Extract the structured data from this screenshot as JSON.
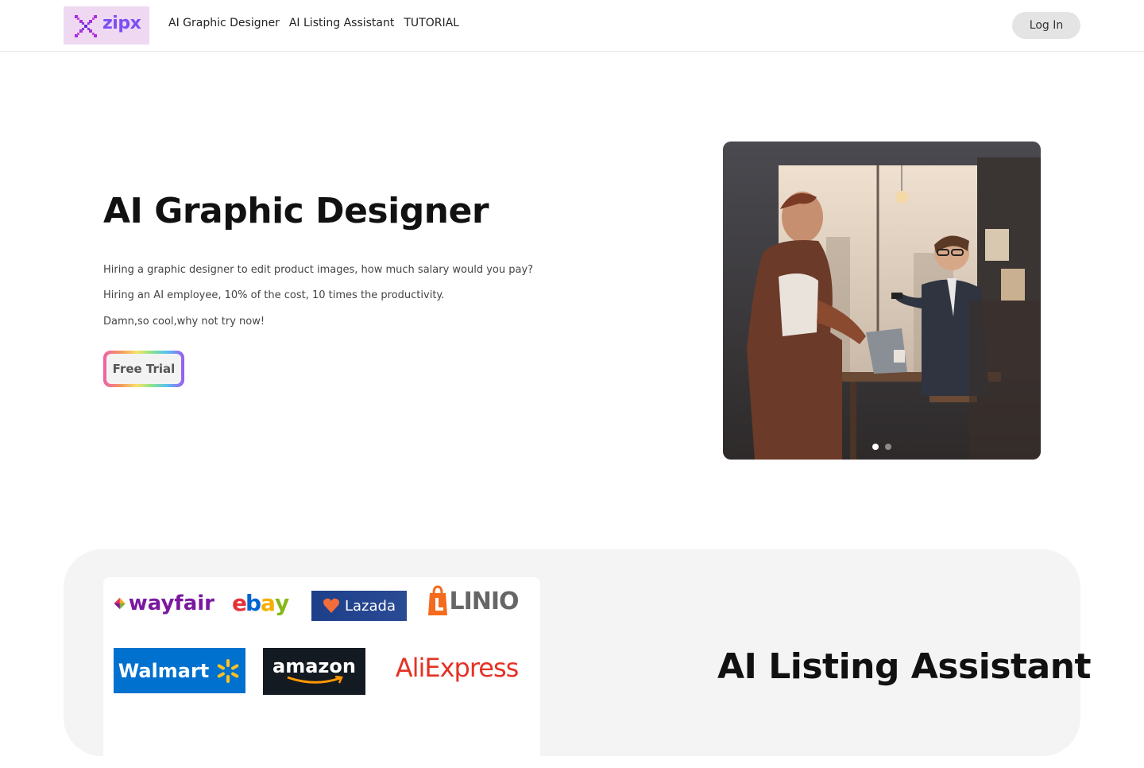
{
  "header": {
    "logo_text": "zipx",
    "nav": [
      "AI Graphic Designer",
      "AI Listing Assistant",
      "TUTORIAL"
    ],
    "login_label": "Log In"
  },
  "hero": {
    "title": "AI Graphic Designer",
    "lines": [
      "Hiring a graphic designer to edit product images, how much salary would you pay?",
      "Hiring an AI employee, 10% of the cost, 10 times the productivity.",
      "Damn,so cool,why not try now!"
    ],
    "cta_label": "Free Trial",
    "carousel_slides": 2,
    "carousel_active": 1
  },
  "listing": {
    "title": "AI Listing Assistant",
    "brands": [
      "wayfair",
      "ebay",
      "Lazada",
      "LINIO",
      "Walmart",
      "amazon",
      "AliExpress"
    ]
  },
  "colors": {
    "brand_purple": "#7b4ff5",
    "logo_bg": "#efd9f2",
    "login_bg": "#e4e4e4",
    "section_bg": "#f4f4f4"
  }
}
